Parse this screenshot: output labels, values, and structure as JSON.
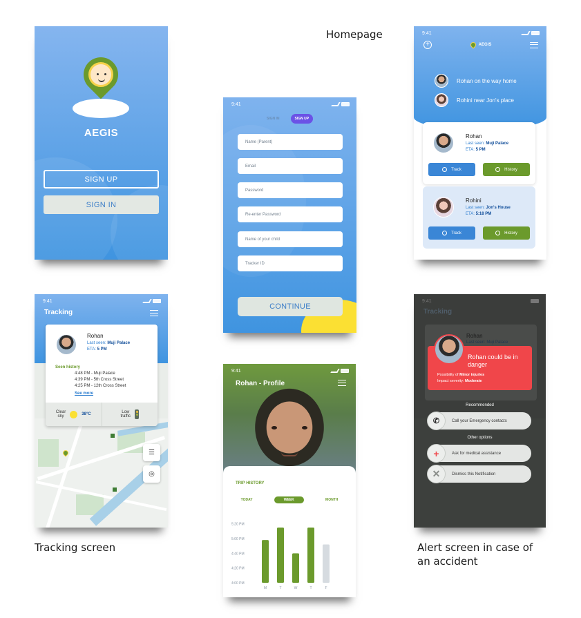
{
  "captions": {
    "homepage": "Homepage",
    "tracking": "Tracking screen",
    "alert_line1": "Alert screen in case of",
    "alert_line2": "an accident"
  },
  "status_time": "9:41",
  "splash": {
    "brand": "AEGIS",
    "signup_label": "SIGN UP",
    "signin_label": "SIGN IN"
  },
  "signup": {
    "tab_signin": "SIGN IN",
    "tab_signup": "SIGN UP",
    "fields": [
      "Name (Parent)",
      "Email",
      "Password",
      "Re-enter Password",
      "Name of your child",
      "Tracker ID"
    ],
    "continue_label": "CONTINUE"
  },
  "home": {
    "brand": "AEGIS",
    "notifications": [
      "Rohan on the way home",
      "Rohini near Jon's place"
    ],
    "kids": [
      {
        "name": "Rohan",
        "seen_prefix": "Last seen: ",
        "seen_place": "Muji Palace",
        "eta_prefix": "ETA: ",
        "eta": "5 PM",
        "track_label": "Track",
        "history_label": "History"
      },
      {
        "name": "Rohini",
        "seen_prefix": "Last seen: ",
        "seen_place": "Jon's House",
        "eta_prefix": "ETA: ",
        "eta": "5:18 PM",
        "track_label": "Track",
        "history_label": "History"
      }
    ]
  },
  "tracking": {
    "title": "Tracking",
    "name": "Rohan",
    "seen_prefix": "Last seen: ",
    "seen_place": "Muji Palace",
    "eta_prefix": "ETA: ",
    "eta": "5 PM",
    "history_title": "Seen history",
    "history": [
      "4:48 PM - Muji Palace",
      "4:39 PM - 5th Cross Street",
      "4:25 PM - 12th Cross Street"
    ],
    "see_more": "See more",
    "weather_label1": "Clear",
    "weather_label2": "sky",
    "temperature": "38°C",
    "traffic_label1": "Low",
    "traffic_label2": "traffic"
  },
  "profile": {
    "title": "Rohan - Profile",
    "trip_title": "TRIP HISTORY",
    "periods": [
      "TODAY",
      "WEEK",
      "MONTH"
    ],
    "selected_period": "WEEK"
  },
  "chart_data": {
    "type": "bar",
    "title": "TRIP HISTORY",
    "categories": [
      "M",
      "T",
      "W",
      "T",
      "F"
    ],
    "values_time_minutes": [
      1018,
      1035,
      1000,
      1035,
      1012
    ],
    "y_tick_labels": [
      "5:20 PM",
      "5:00 PM",
      "4:40 PM",
      "4:20 PM",
      "4:00 PM"
    ],
    "ylim_minutes": [
      960,
      1050
    ],
    "colors": [
      "#6b9a2c",
      "#6b9a2c",
      "#6b9a2c",
      "#6b9a2c",
      "#d6dbe0"
    ]
  },
  "alert": {
    "bg_title": "Tracking",
    "bg_name": "Rohan",
    "bg_seen": "Last seen: Muji Palace",
    "message": "Rohan could be in danger",
    "possibility_prefix": "Possibility of ",
    "possibility": "Minor injuries",
    "severity_prefix": "Impact severity: ",
    "severity": "Moderate",
    "recommended": "Recommended",
    "call_label": "Call your Emergency contacts",
    "other_options": "Other options",
    "medical_label": "Ask for medical assistance",
    "dismiss_label": "Dismiss this Notification"
  },
  "colors": {
    "primary_blue": "#3f94e0",
    "accent_green": "#6b9a2c",
    "alert_red": "#f0464a",
    "accent_yellow": "#fbe033"
  }
}
